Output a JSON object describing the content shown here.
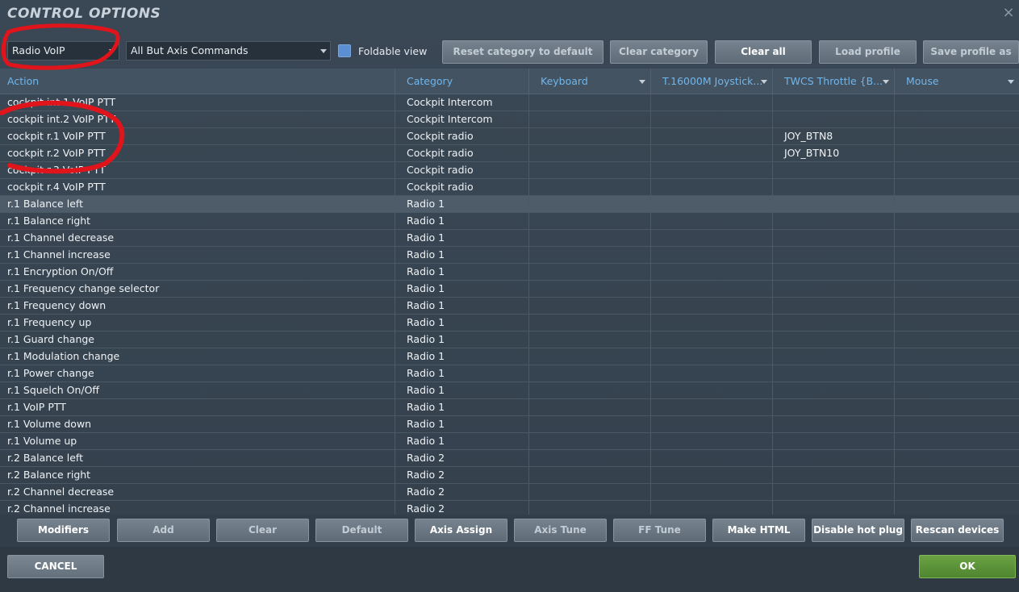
{
  "window": {
    "title": "CONTROL OPTIONS",
    "close_glyph": "×"
  },
  "toolbar": {
    "aircraft_select": "Radio VoIP",
    "filter_select": "All But Axis Commands",
    "foldable_label": "Foldable view",
    "foldable_checked": true,
    "reset_category": "Reset category to default",
    "clear_category": "Clear category",
    "clear_all": "Clear all",
    "load_profile": "Load profile",
    "save_profile": "Save profile as"
  },
  "table": {
    "columns": [
      "Action",
      "Category",
      "Keyboard",
      "T.16000M Joystick...",
      "TWCS Throttle {B...",
      "Mouse"
    ],
    "rows": [
      [
        "cockpit int.1 VoIP PTT",
        "Cockpit Intercom",
        "",
        "",
        "",
        ""
      ],
      [
        "cockpit int.2 VoIP PTT",
        "Cockpit Intercom",
        "",
        "",
        "",
        ""
      ],
      [
        "cockpit r.1 VoIP PTT",
        "Cockpit radio",
        "",
        "",
        "JOY_BTN8",
        ""
      ],
      [
        "cockpit r.2 VoIP PTT",
        "Cockpit radio",
        "",
        "",
        "JOY_BTN10",
        ""
      ],
      [
        "cockpit r.3 VoIP PTT",
        "Cockpit radio",
        "",
        "",
        "",
        ""
      ],
      [
        "cockpit r.4 VoIP PTT",
        "Cockpit radio",
        "",
        "",
        "",
        ""
      ],
      [
        "r.1 Balance left",
        "Radio 1",
        "",
        "",
        "",
        ""
      ],
      [
        "r.1 Balance right",
        "Radio 1",
        "",
        "",
        "",
        ""
      ],
      [
        "r.1 Channel decrease",
        "Radio 1",
        "",
        "",
        "",
        ""
      ],
      [
        "r.1 Channel increase",
        "Radio 1",
        "",
        "",
        "",
        ""
      ],
      [
        "r.1 Encryption On/Off",
        "Radio 1",
        "",
        "",
        "",
        ""
      ],
      [
        "r.1 Frequency change selector",
        "Radio 1",
        "",
        "",
        "",
        ""
      ],
      [
        "r.1 Frequency down",
        "Radio 1",
        "",
        "",
        "",
        ""
      ],
      [
        "r.1 Frequency up",
        "Radio 1",
        "",
        "",
        "",
        ""
      ],
      [
        "r.1 Guard change",
        "Radio 1",
        "",
        "",
        "",
        ""
      ],
      [
        "r.1 Modulation change",
        "Radio 1",
        "",
        "",
        "",
        ""
      ],
      [
        "r.1 Power change",
        "Radio 1",
        "",
        "",
        "",
        ""
      ],
      [
        "r.1 Squelch On/Off",
        "Radio 1",
        "",
        "",
        "",
        ""
      ],
      [
        "r.1 VoIP PTT",
        "Radio 1",
        "",
        "",
        "",
        ""
      ],
      [
        "r.1 Volume down",
        "Radio 1",
        "",
        "",
        "",
        ""
      ],
      [
        "r.1 Volume up",
        "Radio 1",
        "",
        "",
        "",
        ""
      ],
      [
        "r.2 Balance left",
        "Radio 2",
        "",
        "",
        "",
        ""
      ],
      [
        "r.2 Balance right",
        "Radio 2",
        "",
        "",
        "",
        ""
      ],
      [
        "r.2 Channel decrease",
        "Radio 2",
        "",
        "",
        "",
        ""
      ],
      [
        "r.2 Channel increase",
        "Radio 2",
        "",
        "",
        "",
        ""
      ]
    ],
    "selected_row": 6
  },
  "actions": {
    "modifiers": "Modifiers",
    "add": "Add",
    "clear": "Clear",
    "default": "Default",
    "axis_assign": "Axis Assign",
    "axis_tune": "Axis Tune",
    "ff_tune": "FF Tune",
    "make_html": "Make HTML",
    "disable_hot_plug": "Disable hot plug",
    "rescan_devices": "Rescan devices"
  },
  "footer": {
    "cancel": "CANCEL",
    "ok": "OK"
  },
  "colors": {
    "header_text": "#6fb6ec",
    "ok_green": "#5a9238",
    "annotation_red": "#e0141b",
    "checkbox_blue": "#5b8fd1"
  },
  "icons": {
    "close": "close-icon",
    "dropdown": "chevron-down-icon"
  }
}
